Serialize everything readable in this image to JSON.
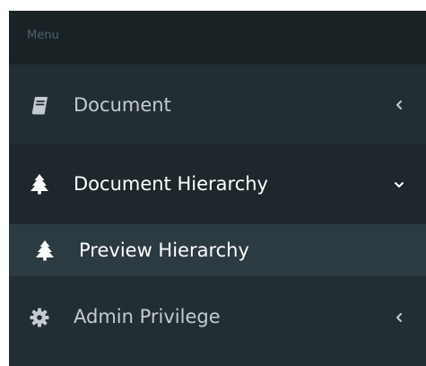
{
  "menu": {
    "header": "Menu",
    "items": [
      {
        "label": "Document",
        "icon": "book-icon",
        "expand_icon": "chevron-left-icon"
      },
      {
        "label": "Document Hierarchy",
        "icon": "tree-icon",
        "expand_icon": "chevron-down-icon"
      },
      {
        "label": "Preview Hierarchy",
        "icon": "tree-icon"
      },
      {
        "label": "Admin Privilege",
        "icon": "gear-icon",
        "expand_icon": "chevron-left-icon"
      }
    ]
  },
  "colors": {
    "sidebar_bg": "#1e282c",
    "header_bg": "#1a2226",
    "submenu_bg": "#2c3b41",
    "text_muted": "#c3cdd1",
    "text_active": "#ffffff"
  }
}
